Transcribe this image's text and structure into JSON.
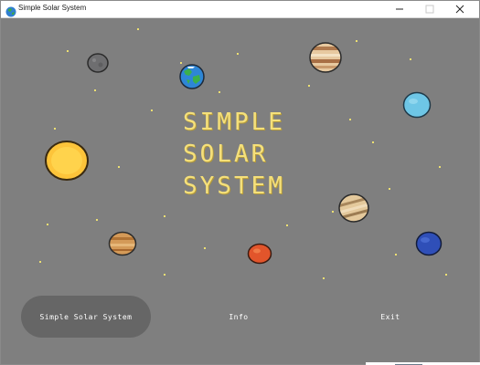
{
  "window": {
    "title": "Simple Solar System",
    "icon": "globe-icon",
    "controls": [
      "minimize-icon",
      "maximize-icon",
      "close-icon"
    ]
  },
  "game": {
    "title_lines": [
      "SIMPLE",
      "SOLAR",
      "SYSTEM"
    ],
    "colors": {
      "background": "#7f7f7f",
      "title": "#f5e07a",
      "star": "#ecdf72",
      "active_button": "#666666"
    },
    "planets": [
      "mercury",
      "earth",
      "jupiter",
      "uranus",
      "sun",
      "saturn",
      "venus",
      "mars",
      "neptune"
    ]
  },
  "menu": {
    "selected": "Simple Solar System",
    "items": [
      {
        "label": "Simple Solar System"
      },
      {
        "label": "Info"
      },
      {
        "label": "Exit"
      }
    ]
  }
}
